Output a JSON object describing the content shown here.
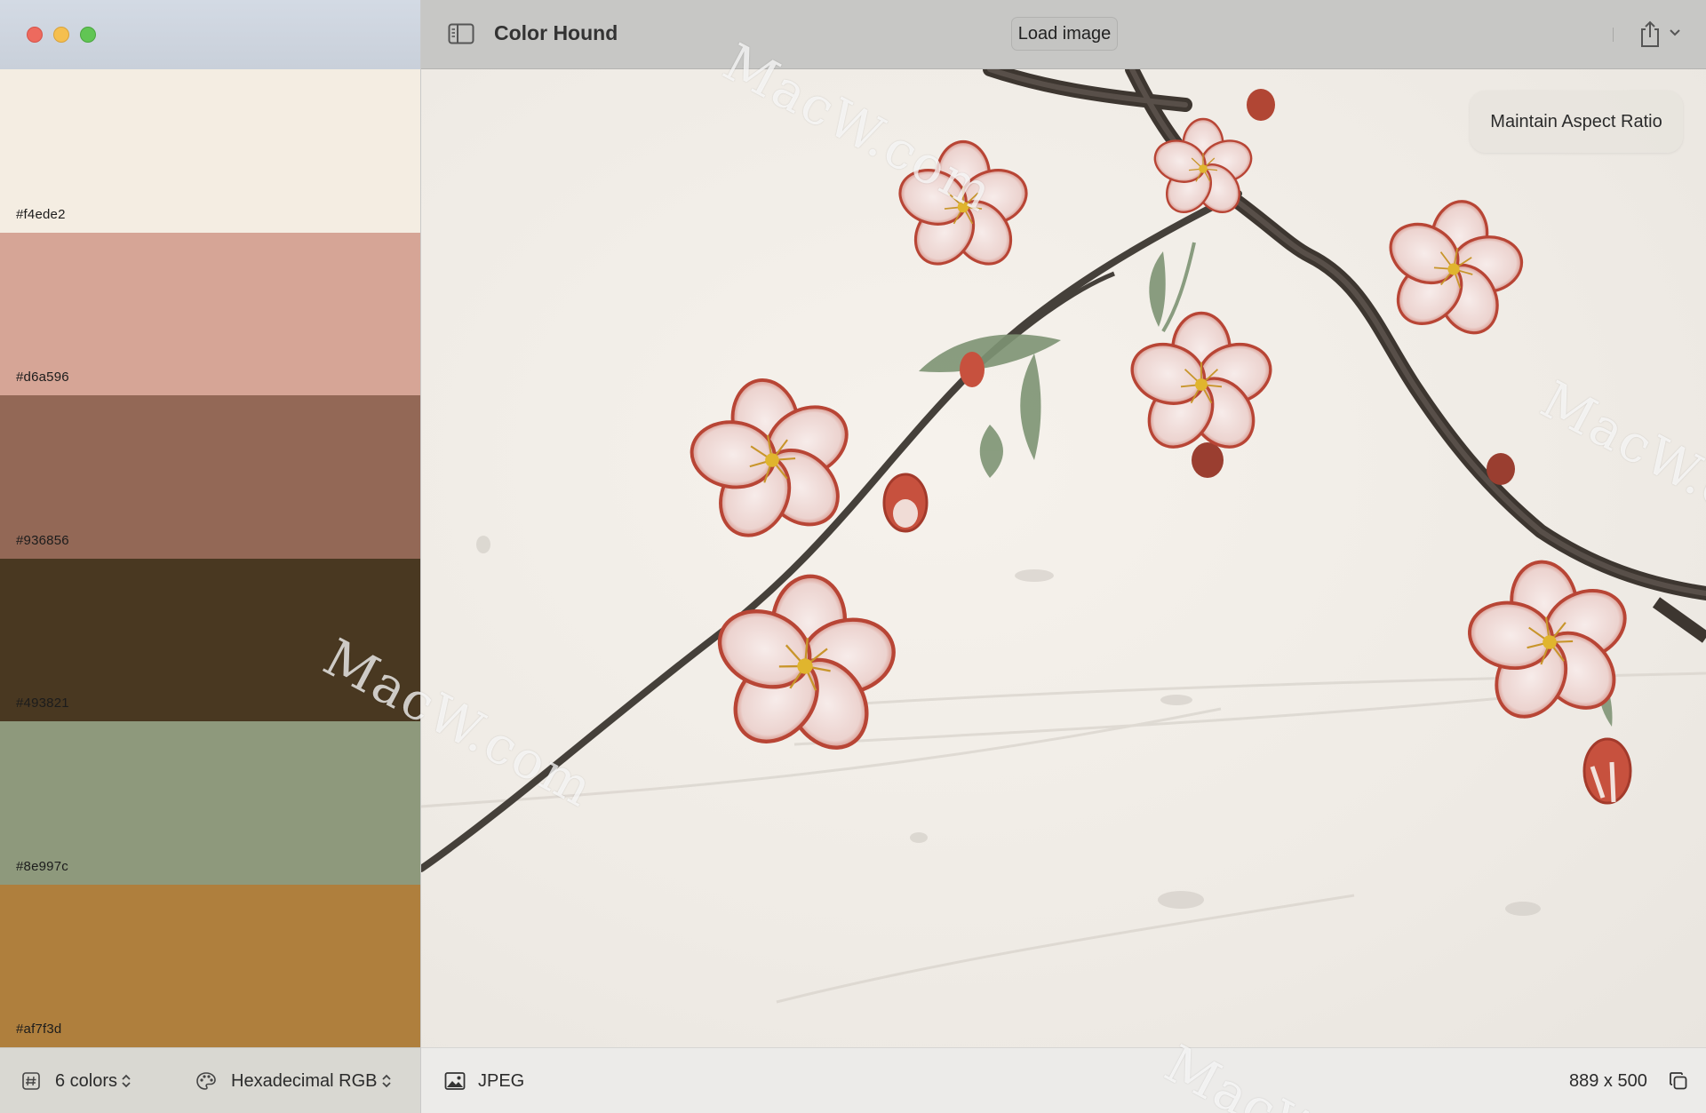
{
  "app": {
    "title": "Color Hound"
  },
  "toolbar": {
    "load_label": "Load image"
  },
  "overlay": {
    "aspect_label": "Maintain Aspect Ratio"
  },
  "palette": {
    "swatches": [
      {
        "hex": "#f4ede2"
      },
      {
        "hex": "#d6a596"
      },
      {
        "hex": "#936856"
      },
      {
        "hex": "#493821"
      },
      {
        "hex": "#8e997c"
      },
      {
        "hex": "#af7f3d"
      }
    ]
  },
  "sidebar_footer": {
    "color_count": "6 colors",
    "format": "Hexadecimal RGB"
  },
  "main_footer": {
    "file_type": "JPEG",
    "dimensions": "889 x 500"
  },
  "watermarks": [
    "MacW.com",
    "MacW.com",
    "MacW.com",
    "MacW"
  ],
  "icons": {
    "sidebar_toggle": "sidebar-toggle-icon",
    "share": "share-icon",
    "image": "photo-icon",
    "copy": "copy-icon",
    "hash": "hash-icon",
    "palette": "palette-icon"
  }
}
